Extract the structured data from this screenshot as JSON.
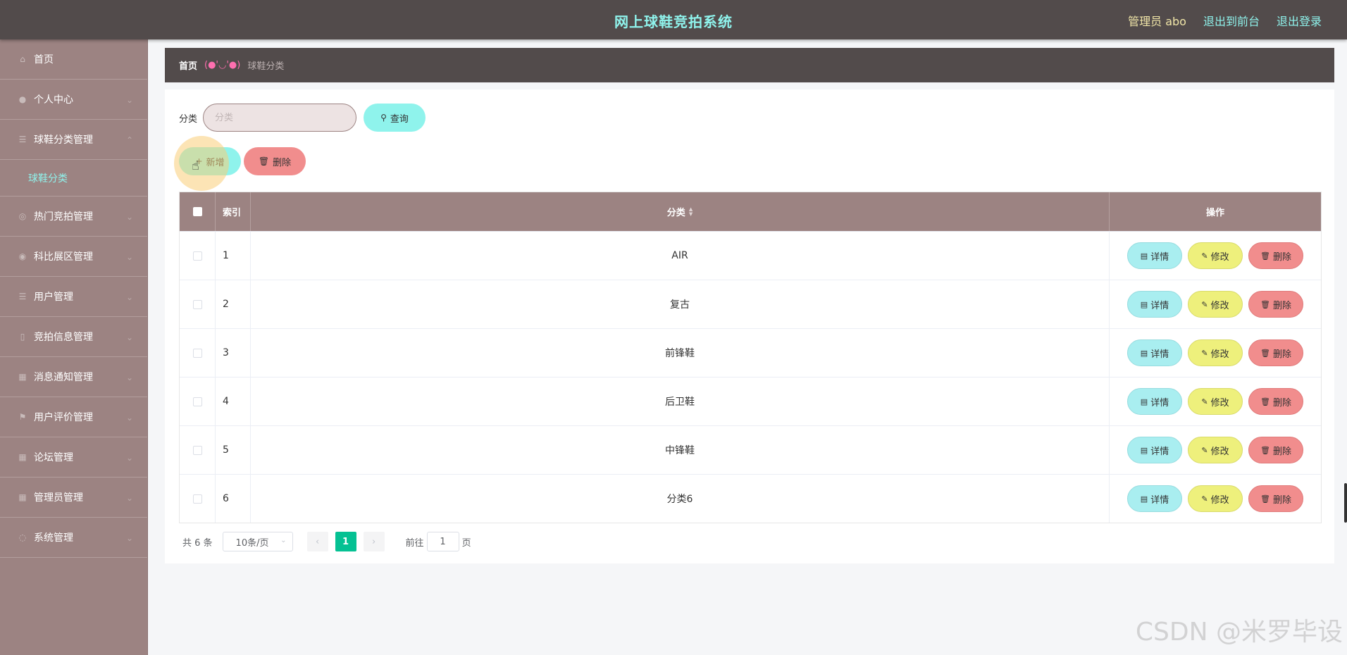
{
  "header": {
    "title": "网上球鞋竞拍系统",
    "admin_label": "管理员 abo",
    "front_link": "退出到前台",
    "logout_link": "退出登录"
  },
  "sidebar": {
    "items": [
      {
        "label": "首页",
        "icon": "home-icon"
      },
      {
        "label": "个人中心",
        "icon": "user-icon"
      },
      {
        "label": "球鞋分类管理",
        "icon": "list-icon"
      },
      {
        "label": "热门竞拍管理",
        "icon": "fire-icon"
      },
      {
        "label": "科比展区管理",
        "icon": "display-icon"
      },
      {
        "label": "用户管理",
        "icon": "users-icon"
      },
      {
        "label": "竞拍信息管理",
        "icon": "document-icon"
      },
      {
        "label": "消息通知管理",
        "icon": "bell-icon"
      },
      {
        "label": "用户评价管理",
        "icon": "flag-icon"
      },
      {
        "label": "论坛管理",
        "icon": "forum-icon"
      },
      {
        "label": "管理员管理",
        "icon": "admin-icon"
      },
      {
        "label": "系统管理",
        "icon": "settings-icon"
      }
    ],
    "sub_item": "球鞋分类"
  },
  "breadcrumb": {
    "home": "首页",
    "separator": "(●'◡'●)",
    "current": "球鞋分类"
  },
  "search": {
    "label": "分类",
    "placeholder": "分类",
    "query_button": "查询"
  },
  "actions": {
    "add_button": "新增",
    "delete_button": "删除"
  },
  "table": {
    "headers": {
      "index": "索引",
      "category": "分类",
      "operations": "操作"
    },
    "row_actions": {
      "detail": "详情",
      "edit": "修改",
      "delete": "删除"
    },
    "rows": [
      {
        "index": "1",
        "category": "AIR"
      },
      {
        "index": "2",
        "category": "复古"
      },
      {
        "index": "3",
        "category": "前锋鞋"
      },
      {
        "index": "4",
        "category": "后卫鞋"
      },
      {
        "index": "5",
        "category": "中锋鞋"
      },
      {
        "index": "6",
        "category": "分类6"
      }
    ]
  },
  "pagination": {
    "total": "共 6 条",
    "page_size": "10条/页",
    "current_page": "1",
    "goto_prefix": "前往",
    "goto_value": "1",
    "goto_suffix": "页"
  },
  "watermark": "CSDN @米罗毕设",
  "colors": {
    "header_bg": "#524b4b",
    "sidebar_bg": "#9c8382",
    "accent_cyan": "#8ff3ec",
    "delete_red": "#f18d8d",
    "edit_yellow": "#eef07c",
    "page_active": "#05c193"
  }
}
